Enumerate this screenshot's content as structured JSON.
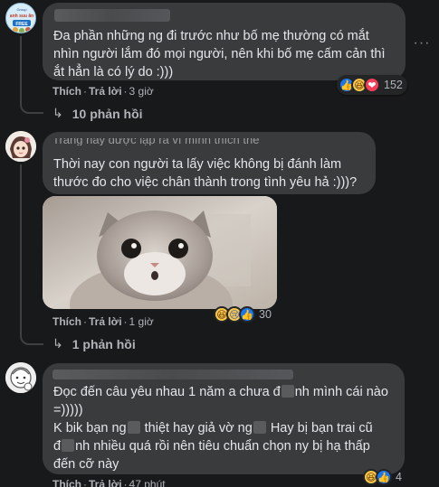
{
  "comments": [
    {
      "author_visible": "",
      "text": "Đa phần những ng đi trước như bố mẹ thường có mắt nhìn người lắm đó mọi người, nên khi bố mẹ cấm cản thì ắt hẳn là có lý do :)))",
      "like_label": "Thích",
      "reply_label": "Trả lời",
      "time": "3 giờ",
      "reaction_icons": [
        "like-icon",
        "haha-icon",
        "love-icon"
      ],
      "reaction_count": "152",
      "replies_label": "10 phản hồi"
    },
    {
      "author_visible": "Trang hay được lập ra vì mình thích thế",
      "text": "Thời nay con người ta lấy việc không bị đánh làm thước đo cho việc chân thành trong tình yêu hả :)))?",
      "like_label": "Thích",
      "reply_label": "Trả lời",
      "time": "1 giờ",
      "reaction_icons": [
        "haha-icon",
        "sad-icon",
        "like-icon"
      ],
      "reaction_count": "30",
      "replies_label": "1 phản hồi"
    },
    {
      "author_visible": "",
      "line1": "Đọc đến câu yêu nhau 1 năm a chưa đ",
      "line1_tail": "nh mình cái nào",
      "line2": "=)))))",
      "line3_a": "K bik bạn ng",
      "line3_b": " thiệt hay giả vờ ng",
      "line3_c": " Hay bị bạn trai cũ",
      "line4_a": "đ",
      "line4_b": "nh nhiều quá rồi nên tiêu chuẩn chọn ny bị hạ thấp",
      "line5": "đến cỡ này",
      "like_label": "Thích",
      "reply_label": "Trả lời",
      "time": "47 phút",
      "reaction_icons": [
        "haha-icon",
        "like-icon"
      ],
      "reaction_count": "4"
    }
  ],
  "avatar1_text": "Group\nanh suu ăn\nFREE",
  "colors": {
    "background": "#18191a",
    "bubble": "#3a3b3c",
    "meta": "#b0b3b8",
    "like": "#1877f2"
  }
}
